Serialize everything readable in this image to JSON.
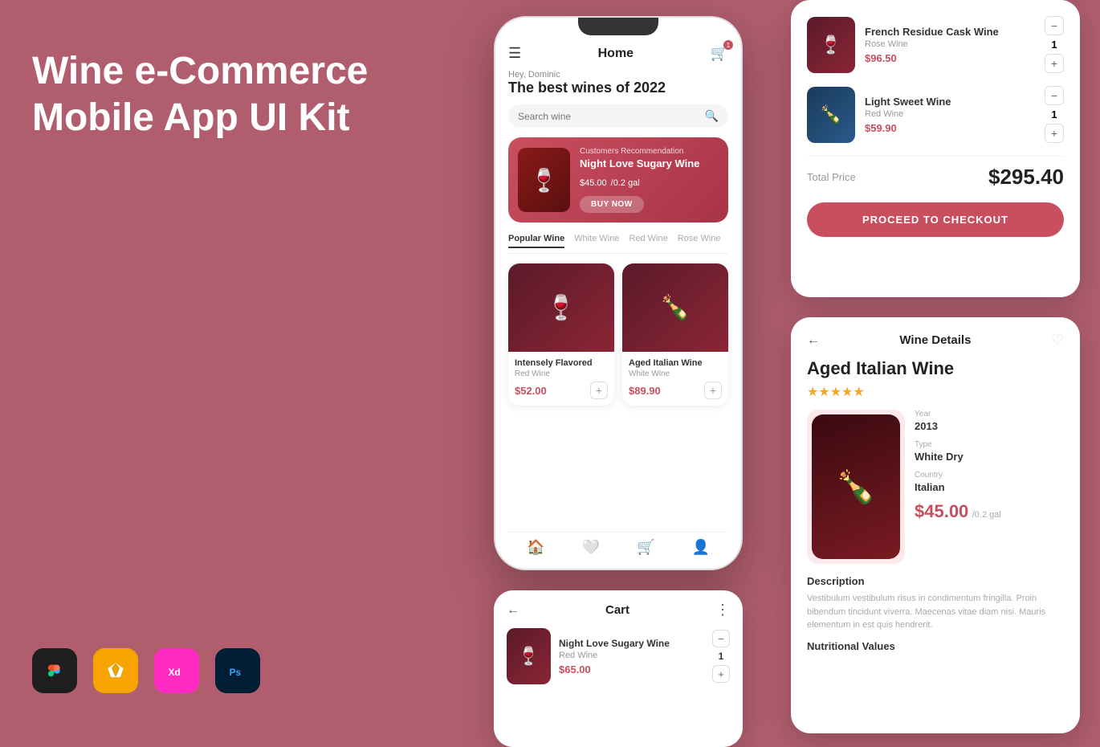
{
  "hero": {
    "title": "Wine e-Commerce\nMobile App UI Kit"
  },
  "phone_main": {
    "header": {
      "title": "Home",
      "cart_badge": "1"
    },
    "greeting": {
      "small": "Hey, Dominic",
      "big": "The best wines of 2022"
    },
    "search": {
      "placeholder": "Search wine"
    },
    "banner": {
      "label": "Customers Recommendation",
      "wine_name": "Night Love Sugary Wine",
      "price": "$45.00",
      "price_unit": "/0.2 gal",
      "buy_now": "BUY NOW"
    },
    "tabs": [
      "Popular Wine",
      "White Wine",
      "Red Wine",
      "Rose Wine"
    ],
    "active_tab": "Popular Wine",
    "wine_cards": [
      {
        "name": "Intensely Flavored",
        "type": "Red Wine",
        "price": "$52.00"
      },
      {
        "name": "Aged Italian Wine",
        "type": "White Wine",
        "price": "$89.90"
      }
    ],
    "bottom_nav": [
      "home",
      "heart",
      "cart",
      "user"
    ]
  },
  "cart_panel": {
    "title": "Cart",
    "item": {
      "name": "Night Love Sugary Wine",
      "type": "Red Wine",
      "price": "$65.00",
      "qty": "1"
    }
  },
  "cart_summary": {
    "items": [
      {
        "name": "French Residue Cask Wine",
        "type": "Rose Wine",
        "price": "$96.50",
        "qty": "1"
      },
      {
        "name": "Light Sweet Wine",
        "type": "Red Wine",
        "price": "$59.90",
        "qty": "1"
      }
    ],
    "total_label": "Total Price",
    "total": "$295.40",
    "checkout_btn": "PROCEED TO CHECKOUT"
  },
  "wine_detail": {
    "title": "Wine Details",
    "wine_name": "Aged Italian Wine",
    "stars": "★★★★★",
    "specs": {
      "year_label": "Year",
      "year": "2013",
      "type_label": "Type",
      "type": "White Dry",
      "country_label": "Country",
      "country": "Italian"
    },
    "price": "$45.00",
    "price_unit": "/0.2 gal",
    "description_title": "Description",
    "description": "Vestibulum vestibulum risus in condimentum fringilla. Proin bibendum tincidunt viverra. Maecenas vitae diam nisi. Mauris elementum in est quis hendrerit.",
    "nutritional_title": "Nutritional Values"
  },
  "tools": [
    {
      "name": "Figma",
      "symbol": "✦",
      "bg": "#1e1e1e",
      "color": "#fff"
    },
    {
      "name": "Sketch",
      "symbol": "⬡",
      "bg": "#f7a300",
      "color": "#fff"
    },
    {
      "name": "XD",
      "symbol": "XD",
      "bg": "#ff2bc2",
      "color": "#fff"
    },
    {
      "name": "Ps",
      "symbol": "Ps",
      "bg": "#001e36",
      "color": "#31a8ff"
    }
  ]
}
